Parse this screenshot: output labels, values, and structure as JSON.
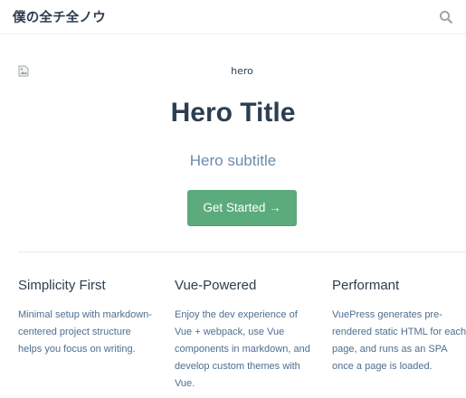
{
  "navbar": {
    "site_name": "僕の全チ全ノウ",
    "search_icon": "search-icon"
  },
  "hero": {
    "image_alt": "hero",
    "title": "Hero Title",
    "subtitle": "Hero subtitle",
    "action_label": "Get Started →"
  },
  "features": [
    {
      "title": "Simplicity First",
      "details": "Minimal setup with markdown-centered project structure helps you focus on writing."
    },
    {
      "title": "Vue-Powered",
      "details": "Enjoy the dev experience of Vue + webpack, use Vue components in markdown, and develop custom themes with Vue."
    },
    {
      "title": "Performant",
      "details": "VuePress generates pre-rendered static HTML for each page, and runs as an SPA once a page is loaded."
    }
  ],
  "colors": {
    "accent": "#5bab7c",
    "text": "#2c3e50",
    "subtitle": "#6a8bad",
    "border": "#eaecef"
  }
}
